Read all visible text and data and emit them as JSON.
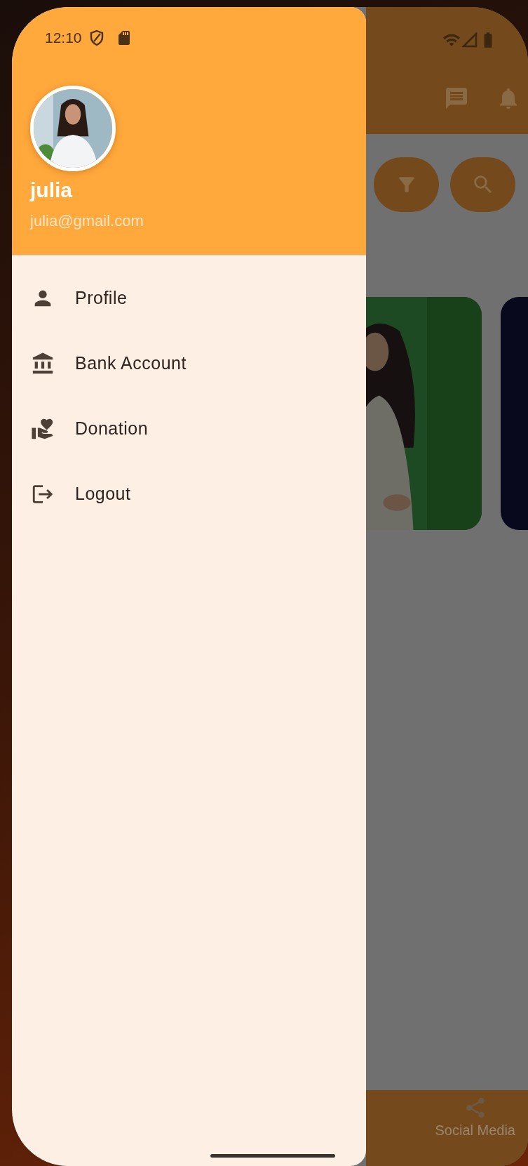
{
  "status_bar": {
    "time": "12:10"
  },
  "drawer": {
    "user": {
      "name": "julia",
      "email": "julia@gmail.com"
    },
    "items": [
      {
        "label": "Profile",
        "kind": "person"
      },
      {
        "label": "Bank Account",
        "kind": "bank"
      },
      {
        "label": "Donation",
        "kind": "donation"
      },
      {
        "label": "Logout",
        "kind": "logout"
      }
    ]
  },
  "background": {
    "bottom_nav": [
      {
        "label": "Social Media",
        "kind": "share"
      }
    ]
  }
}
